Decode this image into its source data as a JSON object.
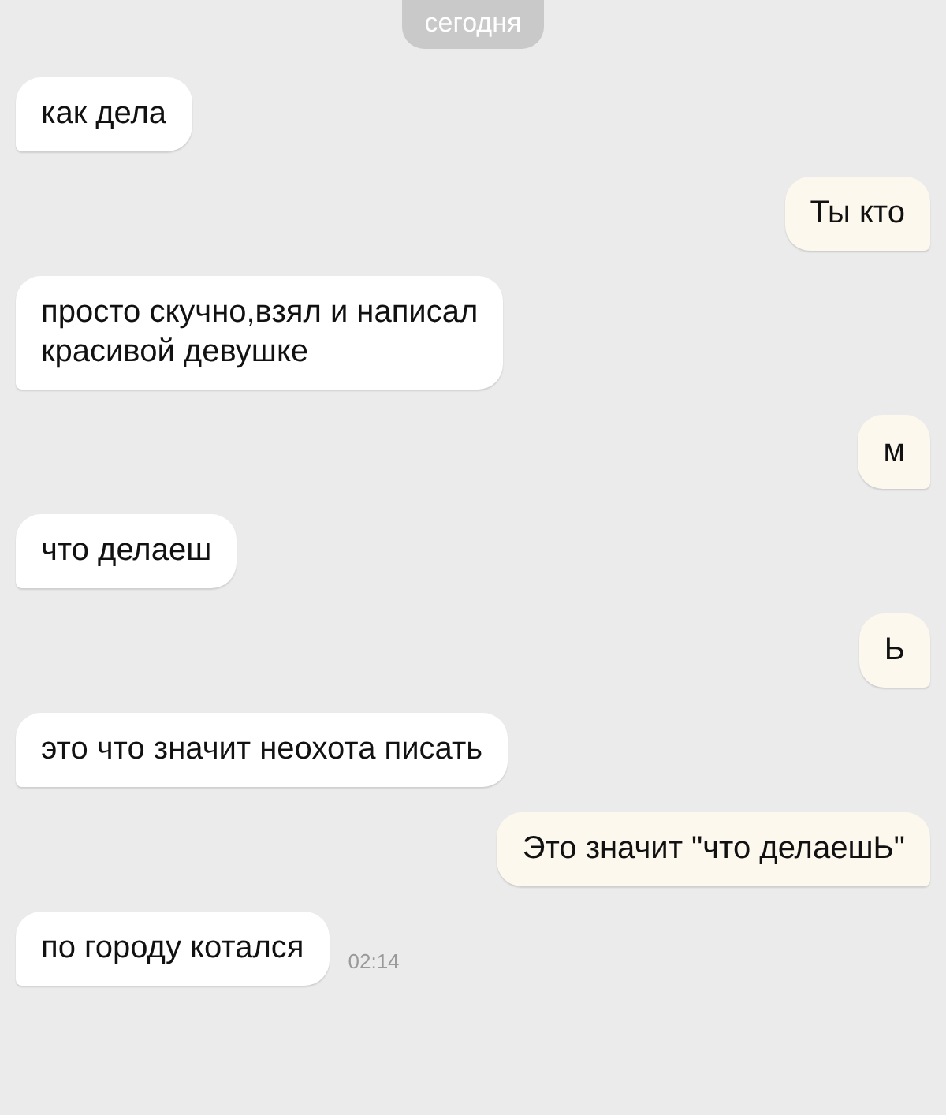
{
  "date_label": "сегодня",
  "messages": [
    {
      "kind": "incoming",
      "text": "как дела"
    },
    {
      "kind": "outgoing",
      "text": "Ты кто"
    },
    {
      "kind": "incoming",
      "text": "просто скучно,взял и написал\nкрасивой девушке"
    },
    {
      "kind": "outgoing",
      "text": "м"
    },
    {
      "kind": "incoming",
      "text": "что делаеш"
    },
    {
      "kind": "outgoing",
      "text": "Ь"
    },
    {
      "kind": "incoming",
      "text": "это что значит неохота писать"
    },
    {
      "kind": "outgoing",
      "text": "Это значит \"что делаешЬ\""
    },
    {
      "kind": "incoming",
      "text": "по городу котался",
      "time": "02:14"
    }
  ]
}
